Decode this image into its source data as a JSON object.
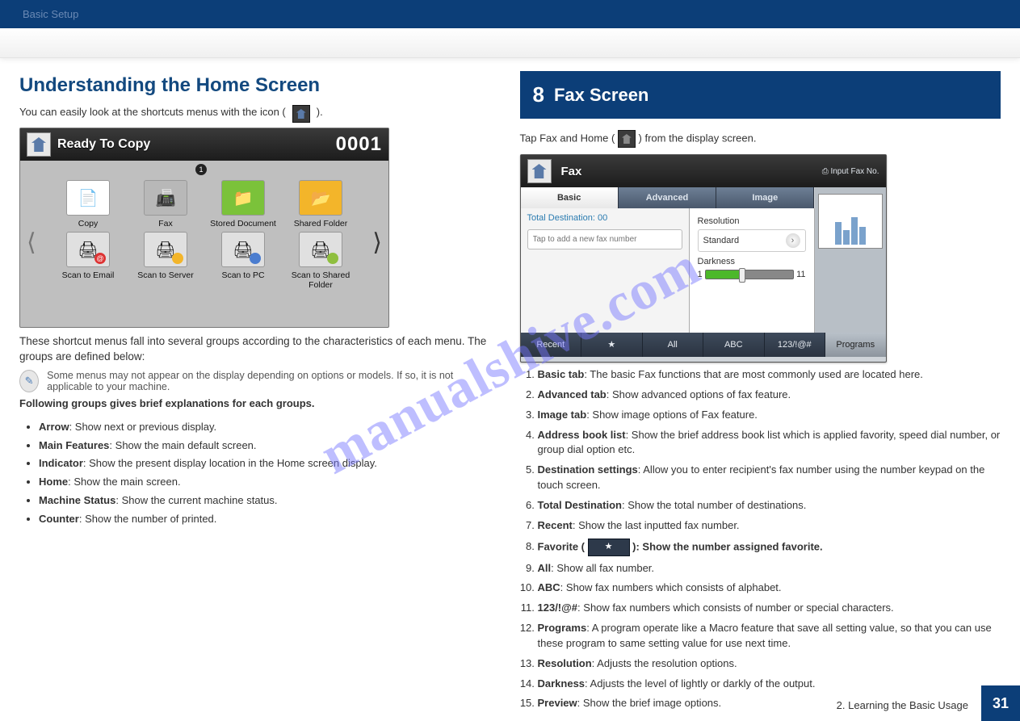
{
  "header": {
    "breadcrumb": "Basic Setup"
  },
  "left": {
    "title": "Understanding the Home Screen",
    "intro_pre": "You can easily look at the shortcuts menus with the icon ( ",
    "intro_post": " ).",
    "panel": {
      "status": "Ready To Copy",
      "count": "0001",
      "page_ind": "1",
      "apps_row1": [
        {
          "name": "copy",
          "label": "Copy"
        },
        {
          "name": "fax",
          "label": "Fax"
        },
        {
          "name": "stored",
          "label": "Stored Document"
        },
        {
          "name": "shared",
          "label": "Shared Folder"
        }
      ],
      "apps_row2": [
        {
          "name": "scan-e",
          "label": "Scan to Email"
        },
        {
          "name": "scan-s",
          "label": "Scan to Server"
        },
        {
          "name": "scan-p",
          "label": "Scan to PC"
        },
        {
          "name": "scan-f",
          "label": "Scan to Shared Folder"
        }
      ]
    },
    "lead1": "These shortcut menus fall into several groups according to the characteristics of each menu. The groups are defined below:",
    "note": "Some menus may not appear on the display depending on options or models. If so, it is not applicable to your machine.",
    "lead2": "Following groups gives brief explanations for each groups.",
    "groups": [
      {
        "name": "Arrow",
        "desc": ": Show next or previous display."
      },
      {
        "name": "Main Features",
        "desc": ": Show the main default screen."
      },
      {
        "name": "Indicator",
        "desc": ": Show the present display location in the Home screen display."
      },
      {
        "name": "Home",
        "desc": ": Show the main screen."
      },
      {
        "name": "Machine Status",
        "desc": ": Show the current machine status."
      },
      {
        "name": "Counter",
        "desc": ": Show the number of printed."
      }
    ]
  },
  "right": {
    "num": "8",
    "title": "Fax Screen",
    "intro_pre": "Tap Fax and Home (",
    "intro_post": ") from the display screen.",
    "panel": {
      "title": "Fax",
      "input_btn": "⎙ Input Fax No.",
      "tabs": [
        "Basic",
        "Advanced",
        "Image"
      ],
      "total_dest_label": "Total Destination:",
      "total_dest_val": "00",
      "placeholder": "Tap to add a new fax number",
      "resolution_label": "Resolution",
      "resolution_value": "Standard",
      "darkness_label": "Darkness",
      "darkness_min": "1",
      "darkness_max": "11",
      "bottom": [
        "Recent",
        "★",
        "All",
        "ABC",
        "123/!@#",
        "Programs"
      ]
    },
    "steps": [
      {
        "t": "Basic tab",
        "d": ": The basic Fax functions that are most commonly used are located here."
      },
      {
        "t": "Advanced tab",
        "d": ": Show advanced options of fax feature."
      },
      {
        "t": "Image tab",
        "d": ": Show image options of Fax feature."
      },
      {
        "t": "Address book list",
        "d": ": Show the brief address book list which is applied favority, speed dial number, or group dial option etc."
      },
      {
        "t": "Destination settings",
        "d": ": Allow you to enter recipient's fax number using the number keypad on the touch screen."
      },
      {
        "t": "Total Destination",
        "d": ": Show the total number of destinations."
      },
      {
        "t": "Recent",
        "d": ": Show the last inputted fax number."
      }
    ],
    "fav_pre": "Favorite (",
    "fav_post": "): Show the number assigned favorite.",
    "steps2": [
      {
        "t": "All",
        "d": ": Show all fax number."
      },
      {
        "t": "ABC",
        "d": ": Show fax numbers which consists of alphabet."
      },
      {
        "t": "123/!@#",
        "d": ": Show fax numbers which consists of number or special characters."
      },
      {
        "t": "Programs",
        "d": ": A program operate like a Macro feature that save all setting value, so that you can use these program to same setting value for use next time."
      },
      {
        "t": "Resolution",
        "d": ": Adjusts the resolution options."
      },
      {
        "t": "Darkness",
        "d": ": Adjusts the level of lightly or darkly of the output."
      },
      {
        "t": "Preview",
        "d": ": Show the brief image options."
      }
    ]
  },
  "footer": {
    "chapter": "2. Learning the Basic Usage",
    "page": "31"
  },
  "watermark": "manualshive.com"
}
